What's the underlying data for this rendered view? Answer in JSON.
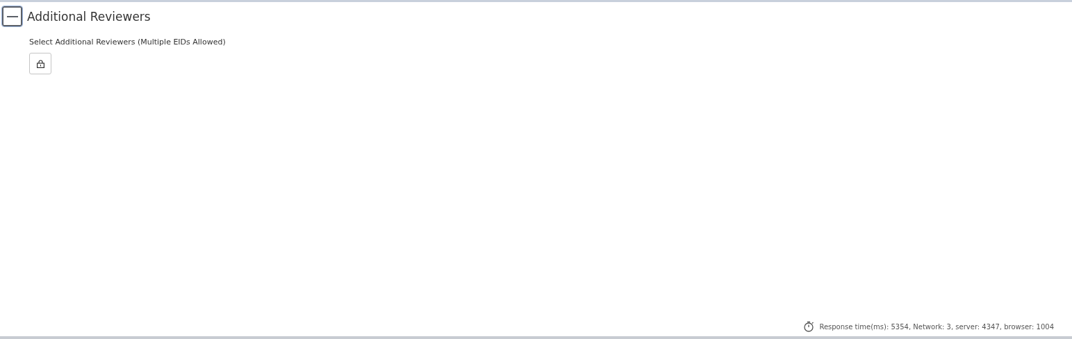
{
  "section": {
    "title": "Additional Reviewers",
    "expanded": true,
    "field": {
      "label": "Select Additional Reviewers (Multiple EIDs Allowed)",
      "locked": true
    }
  },
  "status_bar": {
    "text": "Response time(ms): 5354, Network: 3, server: 4347, browser: 1004"
  }
}
